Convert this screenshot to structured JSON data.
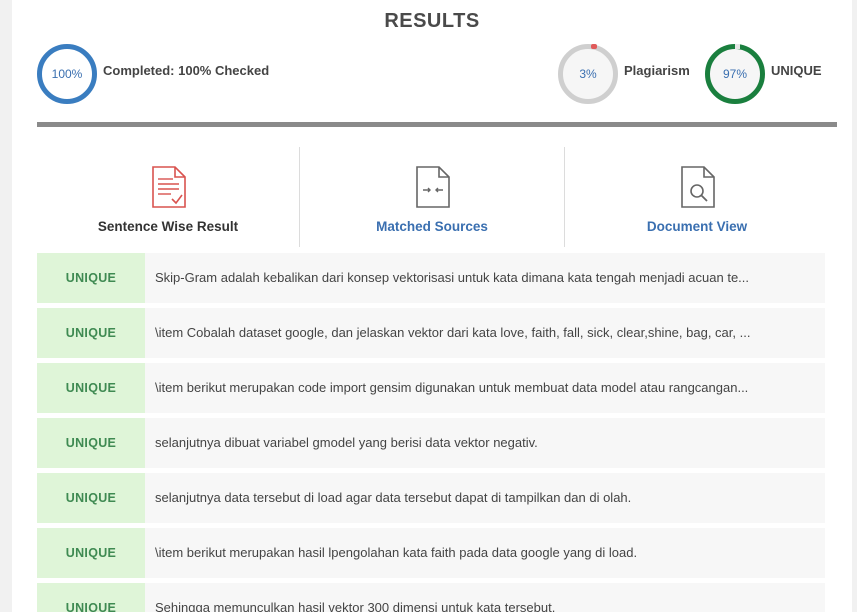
{
  "header": {
    "title": "RESULTS"
  },
  "stats": {
    "completed": {
      "ring_value": "100%",
      "label": "Completed: 100% Checked",
      "color": "#3a7dc0"
    },
    "plagiarism": {
      "ring_value": "3%",
      "label": "Plagiarism",
      "color": "#e05a5a"
    },
    "unique": {
      "ring_value": "97%",
      "label": "UNIQUE",
      "color": "#1a7f3e"
    }
  },
  "tabs": [
    {
      "label": "Sentence Wise Result",
      "icon": "document-check-icon",
      "color": "#333333"
    },
    {
      "label": "Matched Sources",
      "icon": "document-compare-icon",
      "color": "#3a6fb0"
    },
    {
      "label": "Document View",
      "icon": "document-search-icon",
      "color": "#3a6fb0"
    }
  ],
  "results": [
    {
      "badge": "UNIQUE",
      "text": "Skip-Gram adalah kebalikan dari konsep vektorisasi untuk kata dimana kata tengah menjadi acuan te..."
    },
    {
      "badge": "UNIQUE",
      "text": "\\item Cobalah dataset google, dan jelaskan vektor dari kata love, faith, fall, sick, clear,shine, bag, car, ..."
    },
    {
      "badge": "UNIQUE",
      "text": "\\item berikut merupakan code import gensim digunakan untuk membuat data model atau rangcangan..."
    },
    {
      "badge": "UNIQUE",
      "text": "selanjutnya dibuat variabel gmodel yang berisi data vektor negativ."
    },
    {
      "badge": "UNIQUE",
      "text": "selanjutnya data tersebut di load agar data tersebut dapat di tampilkan dan di olah."
    },
    {
      "badge": "UNIQUE",
      "text": "\\item berikut merupakan hasil lpengolahan kata faith pada data google yang di load."
    },
    {
      "badge": "UNIQUE",
      "text": "Sehingga memunculkan hasil vektor 300 dimensi untuk kata tersebut."
    }
  ],
  "colors": {
    "badge_bg": "#dff5d8",
    "badge_text": "#3f8a52",
    "row_bg": "#f7f7f7"
  }
}
